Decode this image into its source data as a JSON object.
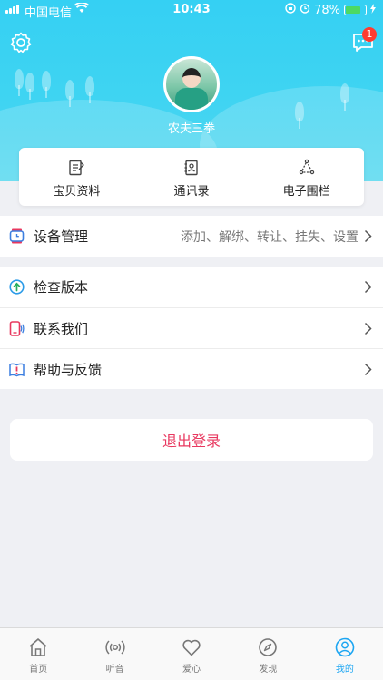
{
  "status_bar": {
    "carrier": "中国电信",
    "time": "10:43",
    "battery": "78%",
    "battery_level": 0.78
  },
  "header": {
    "nickname": "农夫三拳",
    "message_badge": "1",
    "settings_icon": "gear-icon",
    "message_icon": "chat-bubble-icon"
  },
  "quick_actions": [
    {
      "label": "宝贝资料",
      "icon": "document-edit-icon"
    },
    {
      "label": "通讯录",
      "icon": "contacts-book-icon"
    },
    {
      "label": "电子围栏",
      "icon": "geofence-icon"
    }
  ],
  "device_group": {
    "title": "设备管理",
    "detail": "添加、解绑、转让、挂失、设置",
    "icon": "watch-icon"
  },
  "menu": [
    {
      "title": "检查版本",
      "icon": "upgrade-arrow-icon"
    },
    {
      "title": "联系我们",
      "icon": "phone-call-icon"
    },
    {
      "title": "帮助与反馈",
      "icon": "help-book-icon"
    }
  ],
  "logout_label": "退出登录",
  "tabs": [
    {
      "label": "首页",
      "icon": "home-icon",
      "active": false
    },
    {
      "label": "听音",
      "icon": "listen-signal-icon",
      "active": false
    },
    {
      "label": "爱心",
      "icon": "heart-icon",
      "active": false
    },
    {
      "label": "发现",
      "icon": "compass-icon",
      "active": false
    },
    {
      "label": "我的",
      "icon": "user-icon",
      "active": true
    }
  ],
  "colors": {
    "header": "#35d0f3",
    "accent": "#1da6f2",
    "logout": "#e8385f",
    "badge": "#ff3b30"
  }
}
